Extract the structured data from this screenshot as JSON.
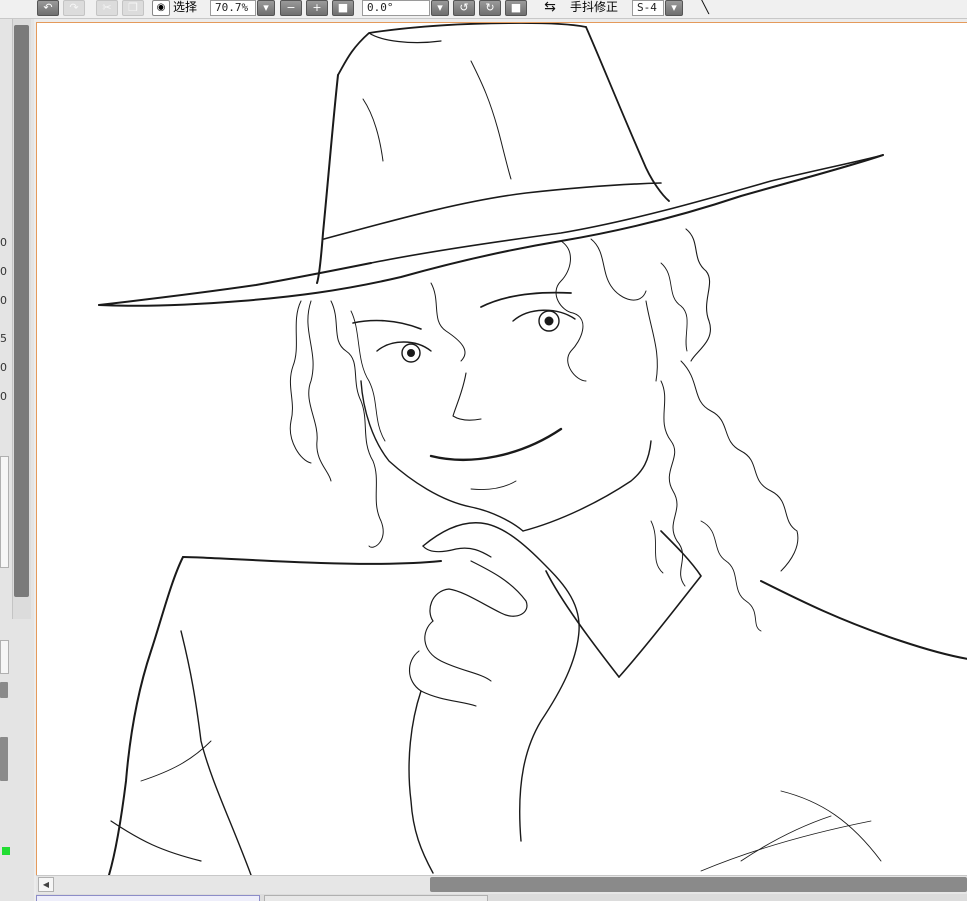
{
  "toolbar": {
    "icons": [
      "undo-icon",
      "redo-icon",
      "cut-icon",
      "copy-icon",
      "eye-icon",
      "zoom-out-icon",
      "zoom-in-icon",
      "fit-icon",
      "rotate-left-icon",
      "rotate-right-icon",
      "reset-rotation-icon",
      "flip-icon",
      "pen-icon"
    ],
    "select_label": "选择",
    "zoom_value": "70.7%",
    "rotation_value": "0.0°",
    "stabilizer_label": "手抖修正",
    "stabilizer_value": "S-4"
  },
  "left_panel": {
    "values": [
      "0",
      "0",
      "0",
      "5",
      "0",
      "0"
    ]
  },
  "colors": {
    "canvas_border": "#e49a5b",
    "toolbar_bg": "#f0f0f0",
    "scroll_thumb": "#8a8a8a",
    "indicator_green": "#22dd33"
  },
  "canvas": {
    "content": "line-art sketch"
  }
}
